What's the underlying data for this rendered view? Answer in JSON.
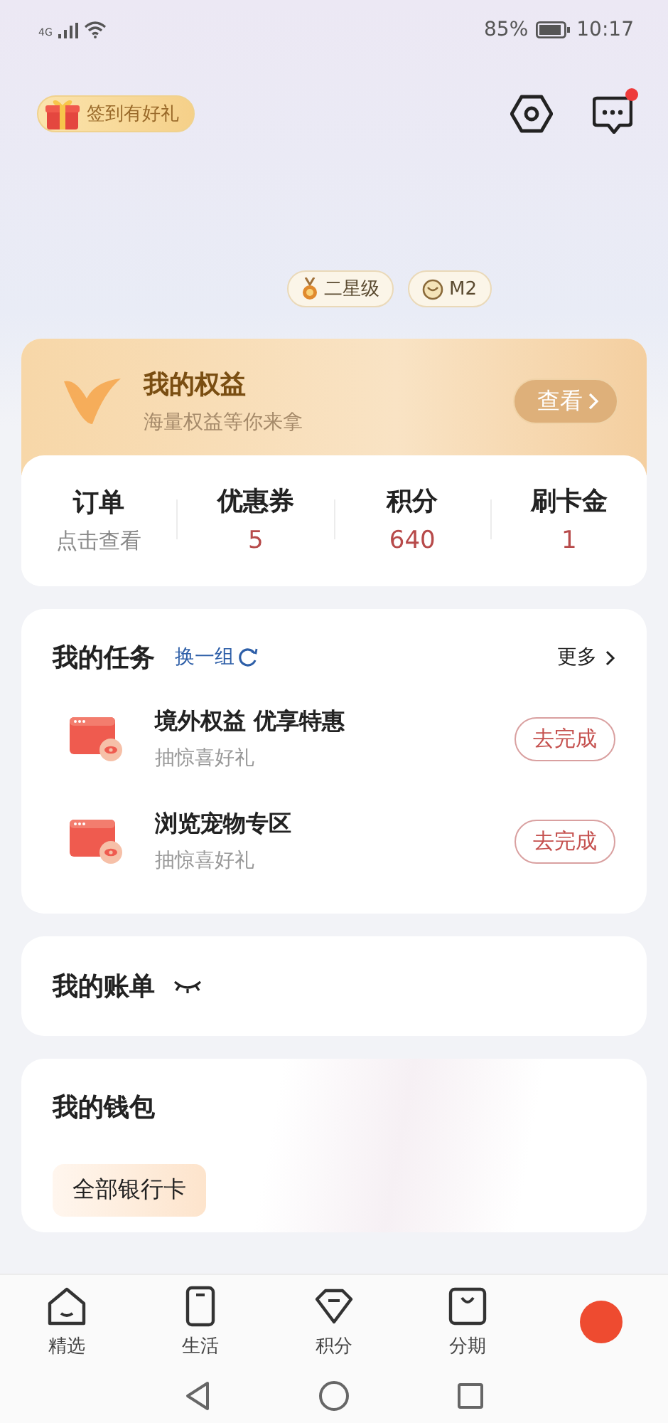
{
  "status_bar": {
    "network": "4G",
    "battery_text": "85%",
    "time": "10:17"
  },
  "header": {
    "signin_label": "签到有好礼",
    "has_message": true
  },
  "badges": [
    {
      "kind": "star",
      "label": "二星级"
    },
    {
      "kind": "member",
      "label": "M2"
    }
  ],
  "benefits": {
    "title": "我的权益",
    "subtitle": "海量权益等你来拿",
    "button": "查看"
  },
  "stats": [
    {
      "label": "订单",
      "value": "点击查看",
      "kind": "link"
    },
    {
      "label": "优惠券",
      "value": "5",
      "kind": "number"
    },
    {
      "label": "积分",
      "value": "640",
      "kind": "number"
    },
    {
      "label": "刷卡金",
      "value": "1",
      "kind": "number"
    }
  ],
  "tasks": {
    "title": "我的任务",
    "refresh": "换一组",
    "more": "更多",
    "items": [
      {
        "title": "境外权益 优享特惠",
        "subtitle": "抽惊喜好礼",
        "button": "去完成"
      },
      {
        "title": "浏览宠物专区",
        "subtitle": "抽惊喜好礼",
        "button": "去完成"
      }
    ]
  },
  "bill": {
    "title": "我的账单",
    "hidden": true
  },
  "wallet": {
    "title": "我的钱包",
    "item": "全部银行卡"
  },
  "tabs": [
    {
      "label": "精选",
      "selected": false,
      "kind": "home"
    },
    {
      "label": "生活",
      "selected": false,
      "kind": "phone"
    },
    {
      "label": "积分",
      "selected": false,
      "kind": "gem"
    },
    {
      "label": "分期",
      "selected": false,
      "kind": "bag"
    },
    {
      "selected": true,
      "kind": "avatar"
    }
  ]
}
